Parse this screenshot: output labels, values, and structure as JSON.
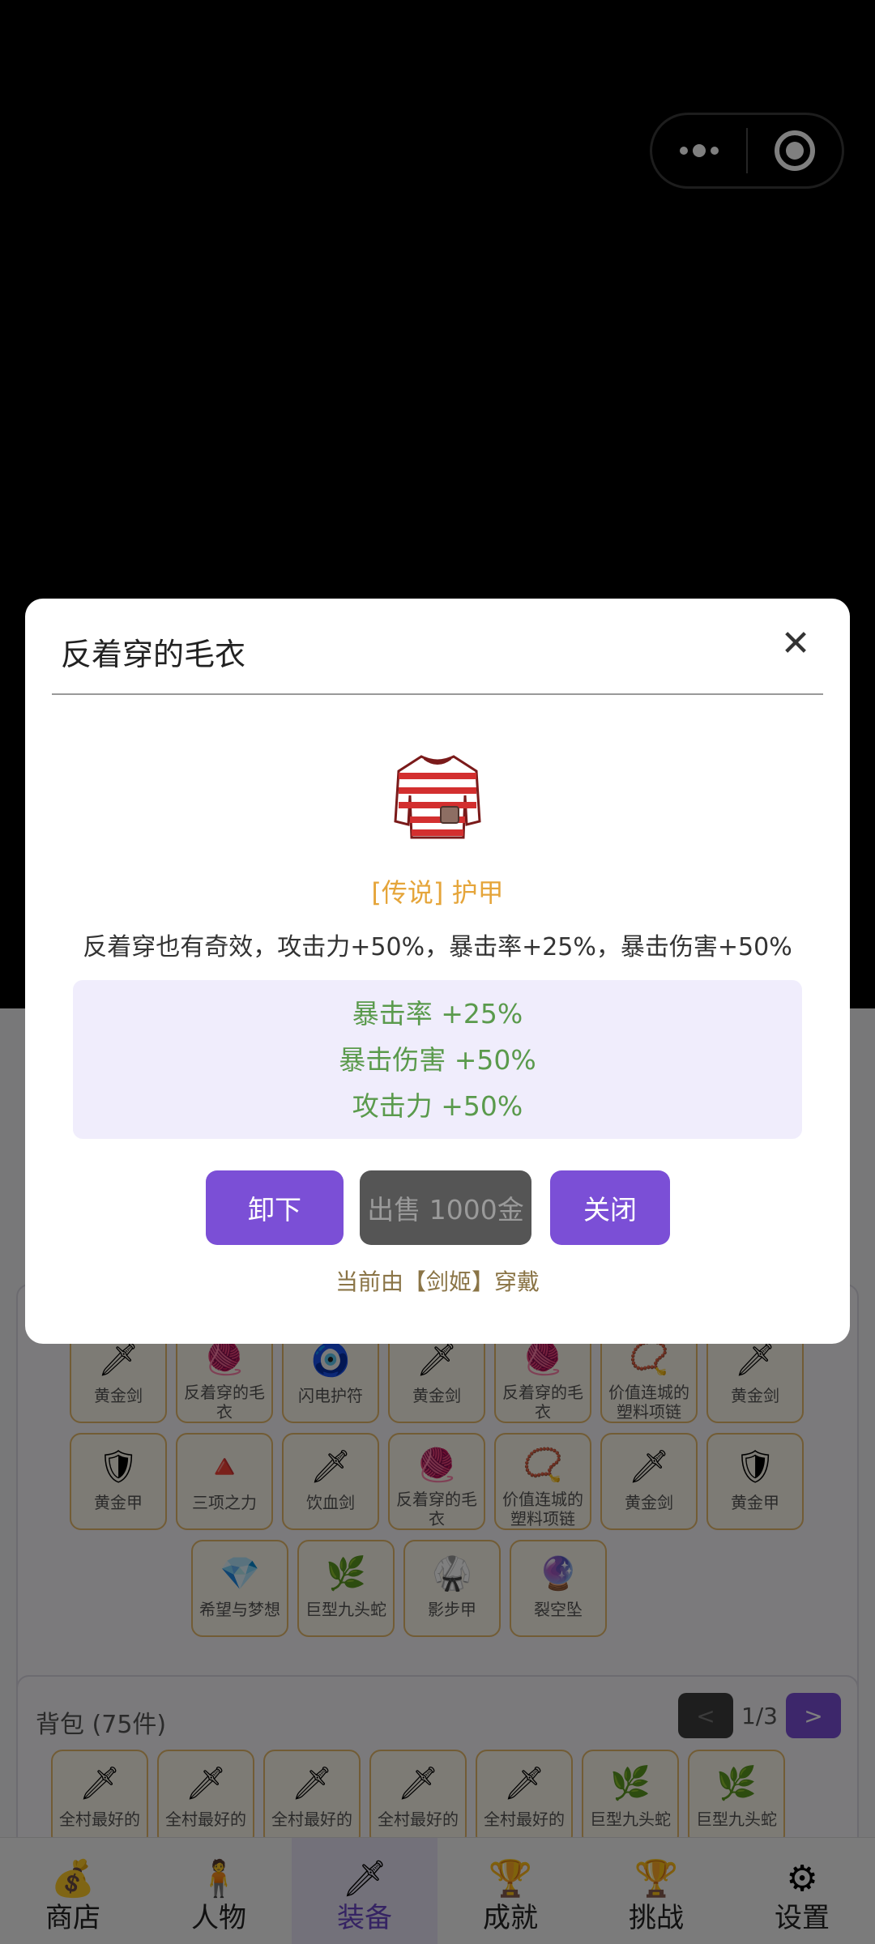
{
  "capsule": {
    "menu_icon": "more-dots-icon",
    "close_icon": "target-circle-icon"
  },
  "modal": {
    "title": "反着穿的毛衣",
    "close_symbol": "✕",
    "rarity_type": "[传说] 护甲",
    "description": "反着穿也有奇效，攻击力+50%，暴击率+25%，暴击伤害+50%",
    "stats": [
      "暴击率 +25%",
      "暴击伤害 +50%",
      "攻击力 +50%"
    ],
    "buttons": {
      "unequip": "卸下",
      "sell": "出售 1000金",
      "close": "关闭"
    },
    "wearer_text": "当前由【剑姬】穿戴",
    "colors": {
      "accent": "#7b4fd6",
      "rarity": "#e5a53a",
      "stat": "#5a9a4c"
    }
  },
  "equipped_items": [
    {
      "name": "黄金剑",
      "icon": "sword-icon"
    },
    {
      "name": "反着穿的毛衣",
      "icon": "sweater-icon"
    },
    {
      "name": "闪电护符",
      "icon": "amulet-icon"
    },
    {
      "name": "黄金剑",
      "icon": "sword-icon"
    },
    {
      "name": "反着穿的毛衣",
      "icon": "sweater-icon"
    },
    {
      "name": "价值连城的塑料项链",
      "icon": "necklace-icon"
    },
    {
      "name": "黄金剑",
      "icon": "sword-icon"
    },
    {
      "name": "黄金甲",
      "icon": "armor-icon"
    },
    {
      "name": "三项之力",
      "icon": "triforce-icon"
    },
    {
      "name": "饮血剑",
      "icon": "blood-sword-icon"
    },
    {
      "name": "反着穿的毛衣",
      "icon": "sweater-icon"
    },
    {
      "name": "价值连城的塑料项链",
      "icon": "necklace-icon"
    },
    {
      "name": "黄金剑",
      "icon": "sword-icon"
    },
    {
      "name": "黄金甲",
      "icon": "armor-icon"
    },
    {
      "name": "希望与梦想",
      "icon": "heart-pendant-icon"
    },
    {
      "name": "巨型九头蛇",
      "icon": "hydra-icon"
    },
    {
      "name": "影步甲",
      "icon": "shadow-armor-icon"
    },
    {
      "name": "裂空坠",
      "icon": "orb-pendant-icon"
    }
  ],
  "bag": {
    "title": "背包 (75件)",
    "page": "1/3",
    "prev": "<",
    "next": ">",
    "items": [
      {
        "name": "全村最好的",
        "icon": "sword-icon"
      },
      {
        "name": "全村最好的",
        "icon": "sword-icon"
      },
      {
        "name": "全村最好的",
        "icon": "sword-icon"
      },
      {
        "name": "全村最好的",
        "icon": "sword-icon"
      },
      {
        "name": "全村最好的",
        "icon": "sword-icon"
      },
      {
        "name": "巨型九头蛇",
        "icon": "hydra-icon"
      },
      {
        "name": "巨型九头蛇",
        "icon": "hydra-icon"
      }
    ]
  },
  "tabs": [
    {
      "label": "商店",
      "icon": "money-bag-icon"
    },
    {
      "label": "人物",
      "icon": "person-icon"
    },
    {
      "label": "装备",
      "icon": "sword-icon",
      "active": true
    },
    {
      "label": "成就",
      "icon": "trophy-icon"
    },
    {
      "label": "挑战",
      "icon": "trophy-icon"
    },
    {
      "label": "设置",
      "icon": "gear-icon"
    }
  ]
}
